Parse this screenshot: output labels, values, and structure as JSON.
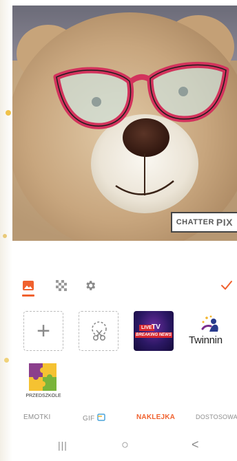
{
  "watermark": {
    "brand": "CHATTER",
    "brand_suffix": "PIX"
  },
  "toolbar": {
    "active_tool": "image",
    "confirm_color": "#f0612e",
    "accent_color": "#f0612e"
  },
  "stickers": [
    {
      "kind": "add",
      "symbol": "+"
    },
    {
      "kind": "cutout"
    },
    {
      "kind": "image",
      "badge": "LIVE",
      "title": "TV",
      "caption": "BREAKING NEWS"
    },
    {
      "kind": "image",
      "label": "Twinnin"
    },
    {
      "kind": "image",
      "label": "PRZEDSZKOLE"
    }
  ],
  "tabs": [
    {
      "label": "EMOTKI",
      "active": false
    },
    {
      "label": "GIF",
      "active": false
    },
    {
      "label": "NAKLEJKA",
      "active": true
    },
    {
      "label": "DOSTOSOWA",
      "active": false
    }
  ],
  "navbar": {
    "recents": "|||",
    "home": "○",
    "back": "<"
  }
}
